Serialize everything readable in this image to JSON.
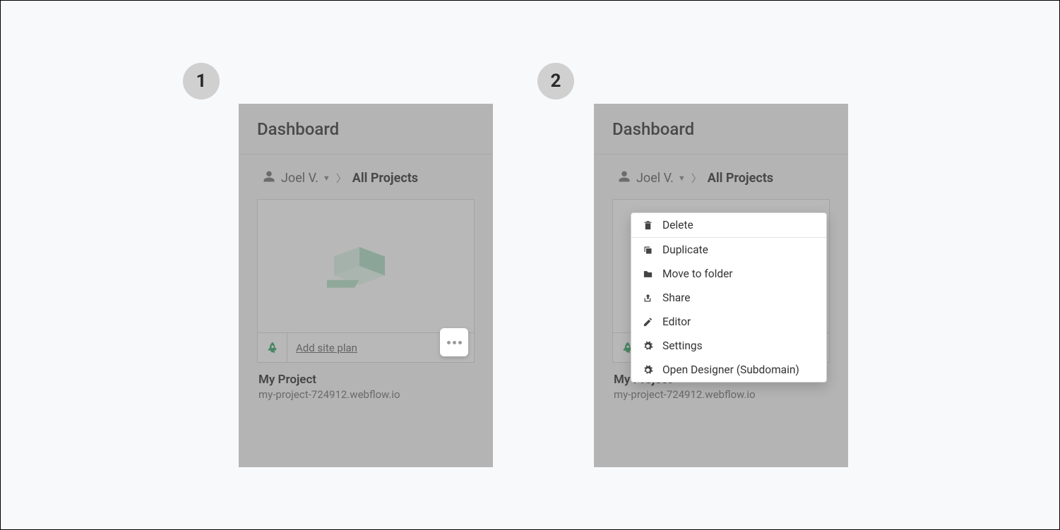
{
  "steps": {
    "one": "1",
    "two": "2"
  },
  "header": {
    "title": "Dashboard"
  },
  "breadcrumb": {
    "user": "Joel V.",
    "current": "All Projects"
  },
  "card": {
    "siteplan_label": "Add site plan"
  },
  "project": {
    "name": "My Project",
    "url": "my-project-724912.webflow.io"
  },
  "menu": {
    "delete": "Delete",
    "duplicate": "Duplicate",
    "move": "Move to folder",
    "share": "Share",
    "editor": "Editor",
    "settings": "Settings",
    "open_designer": "Open Designer (Subdomain)"
  }
}
